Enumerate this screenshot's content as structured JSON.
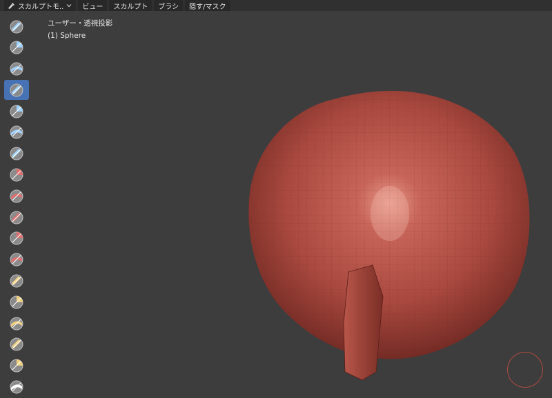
{
  "header": {
    "mode_label": "スカルプトモ..",
    "menus": [
      "ビュー",
      "スカルプト",
      "ブラシ",
      "隠す/マスク"
    ]
  },
  "viewport": {
    "view_label": "ユーザー・透視投影",
    "object_label": "(1) Sphere"
  },
  "toolbar": {
    "tools": [
      {
        "icon": "draw-brush-icon",
        "color": "#9fd0ff"
      },
      {
        "icon": "draw-sharp-brush-icon",
        "color": "#9fd0ff"
      },
      {
        "icon": "clay-brush-icon",
        "color": "#9fd0ff"
      },
      {
        "icon": "clay-strips-brush-icon",
        "color": "#9fd0ff",
        "active": true
      },
      {
        "icon": "clay-thumb-brush-icon",
        "color": "#9fd0ff"
      },
      {
        "icon": "layer-brush-icon",
        "color": "#9fd0ff"
      },
      {
        "icon": "inflate-brush-icon",
        "color": "#9fd0ff"
      },
      {
        "icon": "blob-brush-icon",
        "color": "#e07070"
      },
      {
        "icon": "crease-brush-icon",
        "color": "#e07070"
      },
      {
        "icon": "smooth-brush-icon",
        "color": "#e07070"
      },
      {
        "icon": "flatten-brush-icon",
        "color": "#e07070"
      },
      {
        "icon": "fill-brush-icon",
        "color": "#e07070"
      },
      {
        "icon": "scrape-brush-icon",
        "color": "#f0d080"
      },
      {
        "icon": "multiplane-scrape-brush-icon",
        "color": "#f0d080"
      },
      {
        "icon": "pinch-brush-icon",
        "color": "#f0d080"
      },
      {
        "icon": "grab-brush-icon",
        "color": "#f0d080"
      },
      {
        "icon": "elastic-deform-brush-icon",
        "color": "#f0d080"
      },
      {
        "icon": "snake-hook-brush-icon",
        "color": "#ffffff"
      }
    ]
  },
  "colors": {
    "background": "#3d3d3d",
    "header": "#303030",
    "active_tool": "#4772b3",
    "mesh": "#b5503f",
    "gizmo_ring": "#b04a3e"
  }
}
